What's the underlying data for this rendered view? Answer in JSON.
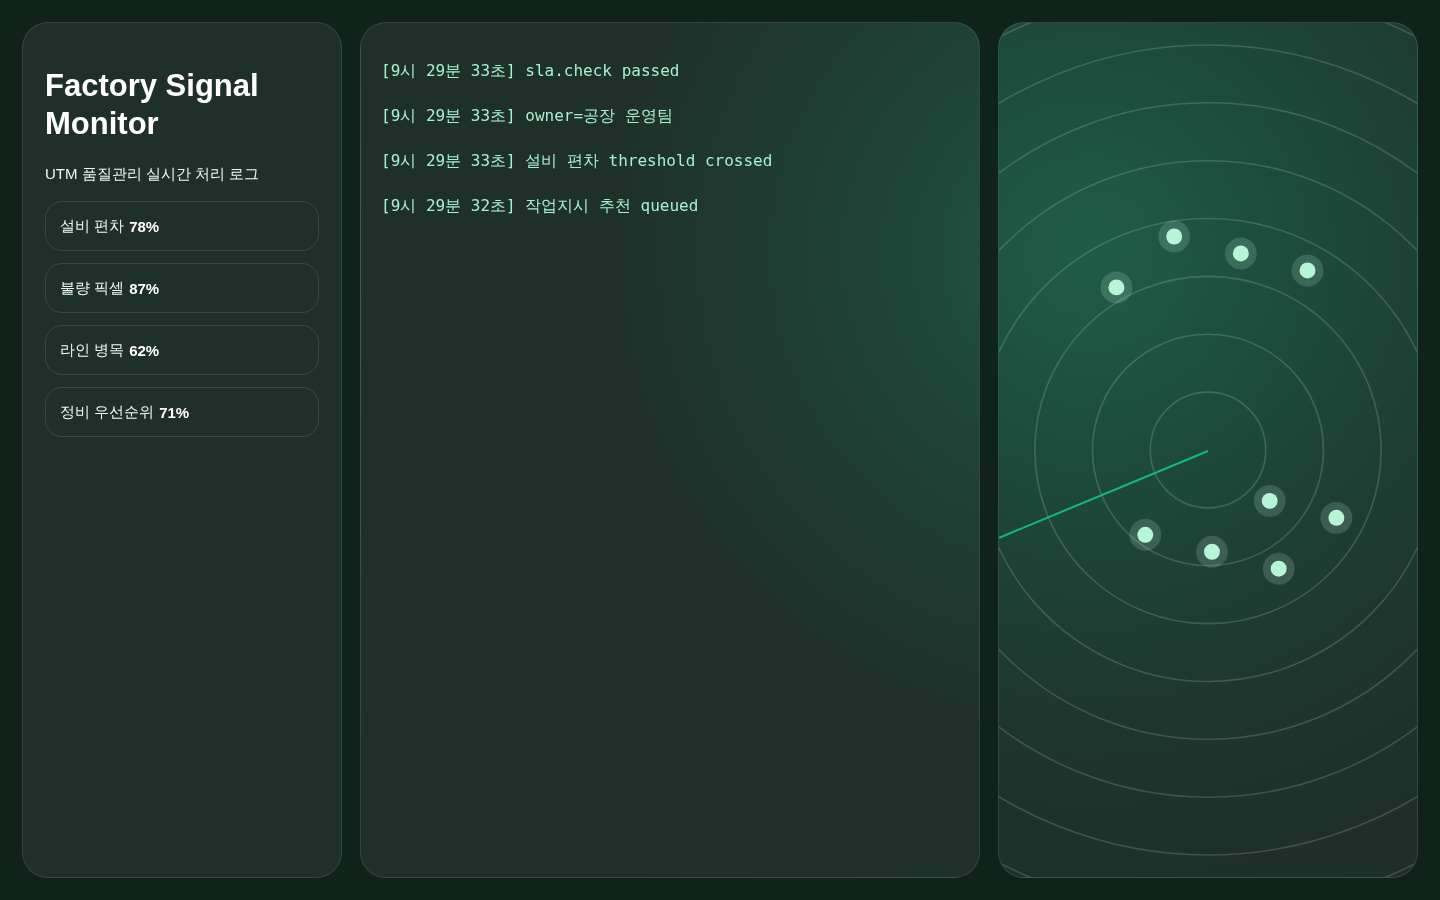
{
  "sidebar": {
    "title": "Factory Signal Monitor",
    "subtitle": "UTM 품질관리 실시간 처리 로그",
    "metrics": [
      {
        "label": "설비 편차",
        "value": "78%"
      },
      {
        "label": "불량 픽셀",
        "value": "87%"
      },
      {
        "label": "라인 병목",
        "value": "62%"
      },
      {
        "label": "정비 우선순위",
        "value": "71%"
      }
    ]
  },
  "log": {
    "entries": [
      {
        "time": "[9시 29분 33초]",
        "message": "sla.check passed"
      },
      {
        "time": "[9시 29분 33초]",
        "message": "owner=공장 운영팀"
      },
      {
        "time": "[9시 29분 33초]",
        "message": "설비 편차 threshold crossed"
      },
      {
        "time": "[9시 29분 32초]",
        "message": "작업지시 추천 queued"
      }
    ]
  }
}
